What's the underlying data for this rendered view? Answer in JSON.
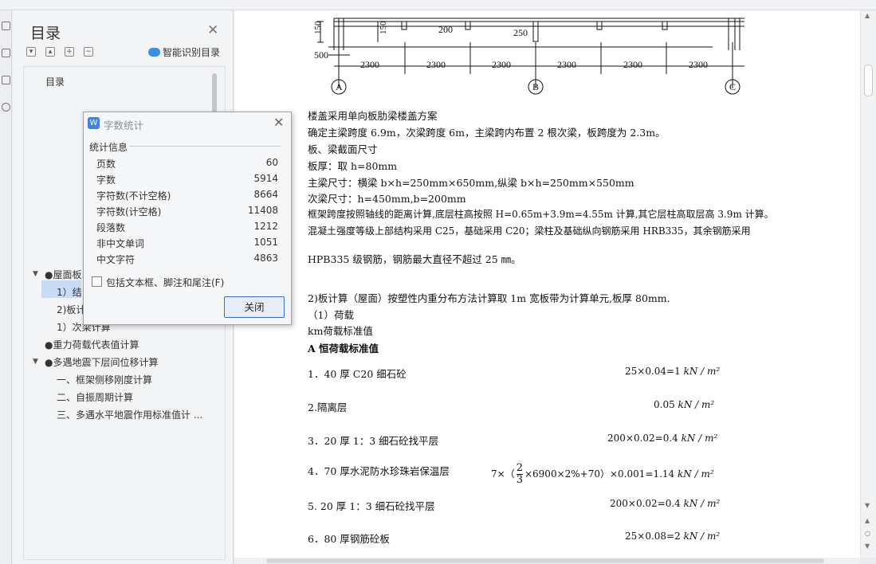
{
  "navigation": {
    "title": "目录",
    "smart_button": "智能识别目录",
    "items": [
      {
        "label": "目录"
      },
      {
        "label": "●屋面板..."
      },
      {
        "label": "1）结"
      },
      {
        "label": "2)板计"
      },
      {
        "label": "1）次梁计算"
      },
      {
        "label": "●重力荷载代表值计算"
      },
      {
        "label": "●多遇地震下层间位移计算"
      },
      {
        "label": "一、框架侧移刚度计算"
      },
      {
        "label": "二、自振周期计算"
      },
      {
        "label": "三、多遇水平地震作用标准值计 ..."
      }
    ]
  },
  "dialog": {
    "title": "字数统计",
    "section": "统计信息",
    "stats": [
      {
        "label": "页数",
        "value": "60"
      },
      {
        "label": "字数",
        "value": "5914"
      },
      {
        "label": "字符数(不计空格)",
        "value": "8664"
      },
      {
        "label": "字符数(计空格)",
        "value": "11408"
      },
      {
        "label": "段落数",
        "value": "1212"
      },
      {
        "label": "非中文单词",
        "value": "1051"
      },
      {
        "label": "中文字符",
        "value": "4863"
      }
    ],
    "checkbox_label": "包括文本框、脚注和尾注(F)",
    "close_button": "关闭"
  },
  "drawing": {
    "dims_top": [
      "200",
      "250"
    ],
    "dims_left": [
      "150",
      "500"
    ],
    "dims_mid": [
      "150"
    ],
    "spans": [
      "2300",
      "2300",
      "2300",
      "2300",
      "2300",
      "2300"
    ],
    "axes": [
      "A",
      "B",
      "C"
    ]
  },
  "document": {
    "lines": [
      "楼盖采用单向板肋梁楼盖方案",
      "确定主梁跨度 6.9m，次梁跨度 6m，主梁跨内布置 2 根次梁，板跨度为 2.3m。",
      "板、梁截面尺寸",
      "板厚：取 h=80mm",
      "主梁尺寸：横梁 b×h=250mm×650mm,纵梁 b×h=250mm×550mm",
      "次梁尺寸：h=450mm,b=200mm",
      "框架跨度按照轴线的距离计算,底层柱高按照 H=0.65m+3.9m=4.55m 计算,其它层柱高取层高 3.9m 计算。",
      "混凝土强度等级上部结构采用 C25，基础采用 C20；梁柱及基础纵向钢筋采用 HRB335，其余钢筋采用",
      "HPB335 级钢筋，钢筋最大直径不超过 25 ㎜。",
      "2)板计算（屋面）按塑性内重分布方法计算取 1m 宽板带为计算单元,板厚 80mm.",
      "（1）荷载",
      "km荷载标准值",
      "A 恒荷载标准值"
    ],
    "loads": [
      {
        "label": "1．40 厚 C20 细石砼",
        "value": "25×0.04=1",
        "unit": "kN / m²"
      },
      {
        "label": "2.隔离层",
        "value": "0.05",
        "unit": "kN / m²"
      },
      {
        "label": "3．20 厚 1：3 细石砼找平层",
        "value": "200×0.02=0.4",
        "unit": "kN / m²"
      },
      {
        "label": "4．70 厚水泥防水珍珠岩保温层",
        "formula_prefix": "7×（",
        "fraction_num": "2",
        "fraction_den": "3",
        "formula_suffix": "×6900×2%+70）×0.001=1.14",
        "unit": "kN / m²"
      },
      {
        "label": "5. 20 厚 1：3 细石砼找平层",
        "value": "200×0.02=0.4",
        "unit": "kN / m²"
      },
      {
        "label": "6．80 厚钢筋砼板",
        "value": "25×0.08=2",
        "unit": "kN / m²"
      }
    ]
  }
}
